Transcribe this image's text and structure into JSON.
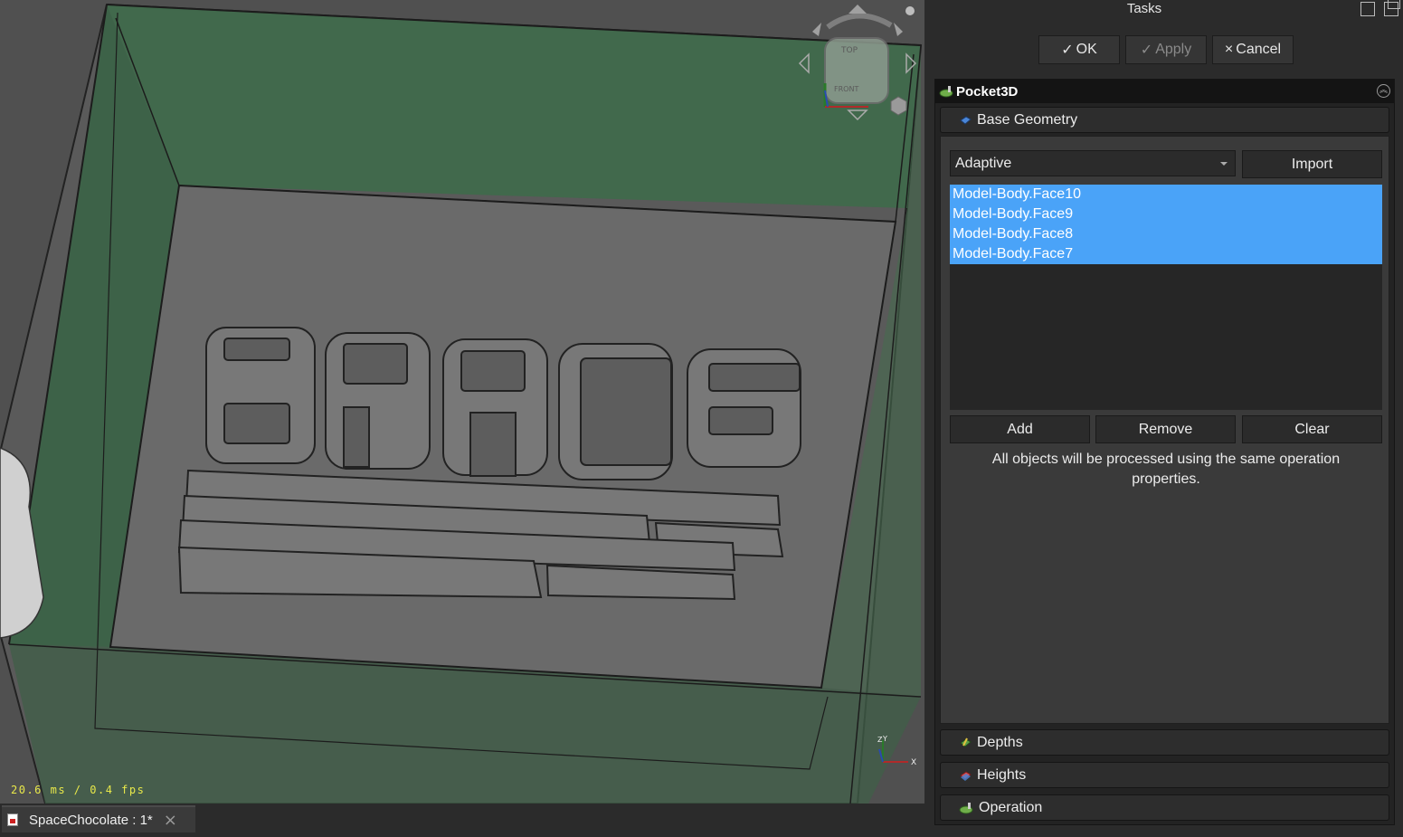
{
  "viewport": {
    "fps_text": "20.6 ms / 0.4 fps",
    "navcube_top_label": "TOP",
    "navcube_front_label": "FRONT",
    "axis_x": "X",
    "axis_y": "Y",
    "axis_z": "Z",
    "model_text": "SPACE"
  },
  "document_tab": {
    "label": "SpaceChocolate : 1*"
  },
  "tasks": {
    "title": "Tasks",
    "ok_label": "OK",
    "apply_label": "Apply",
    "cancel_label": "Cancel",
    "check_glyph": "✓",
    "cross_glyph": "×",
    "panel_title": "Pocket3D",
    "sections": {
      "base_geometry": "Base Geometry",
      "depths": "Depths",
      "heights": "Heights",
      "operation": "Operation"
    },
    "base_geometry": {
      "dropdown_value": "Adaptive",
      "import_label": "Import",
      "items": [
        "Model-Body.Face10",
        "Model-Body.Face9",
        "Model-Body.Face8",
        "Model-Body.Face7"
      ],
      "add_label": "Add",
      "remove_label": "Remove",
      "clear_label": "Clear",
      "info": "All objects will be processed using the same operation properties."
    }
  },
  "colors": {
    "selection": "#4aa3f8",
    "stock_green": "#3e6a4a",
    "fps_yellow": "#e8e84a"
  },
  "icons": [
    "pocket-icon",
    "base-geometry-icon",
    "depths-icon",
    "heights-icon",
    "operation-icon",
    "collapse-icon",
    "close-icon"
  ]
}
